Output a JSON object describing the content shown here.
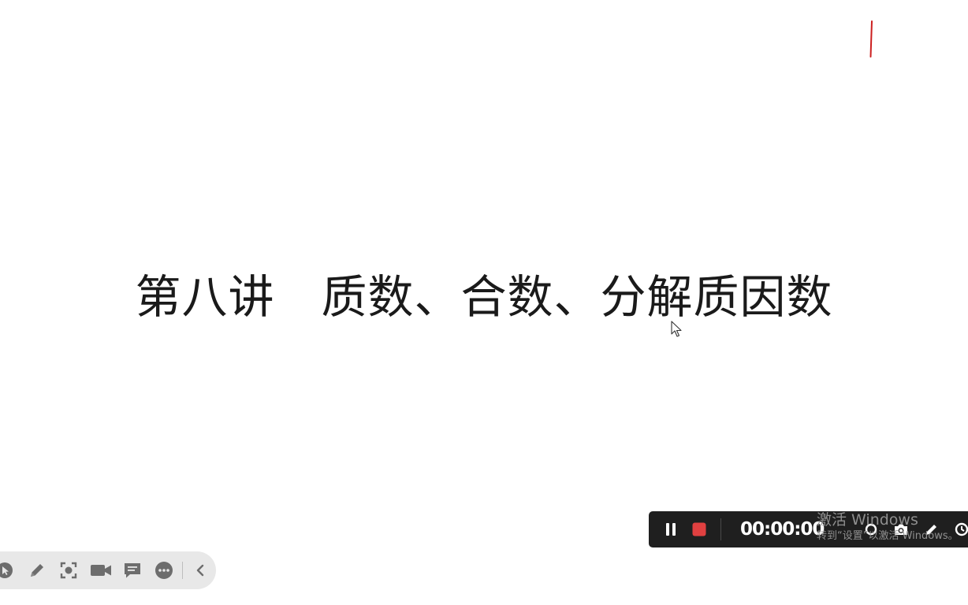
{
  "slide": {
    "title": "第八讲　质数、合数、分解质因数"
  },
  "annotation": {
    "pen_color": "#cc1f1f"
  },
  "left_toolbar": {
    "items": [
      {
        "icon": "pointer-icon"
      },
      {
        "icon": "pen-icon"
      },
      {
        "icon": "spotlight-icon"
      },
      {
        "icon": "camera-icon"
      },
      {
        "icon": "comment-icon"
      },
      {
        "icon": "more-icon"
      },
      {
        "icon": "collapse-chevron-icon"
      }
    ],
    "background": "#e8e8e8",
    "icon_color": "#6d6d6d"
  },
  "recorder": {
    "timer": "00:00:00",
    "stop_color": "#e04040",
    "background": "#1f1f1f",
    "buttons": [
      "pause-icon",
      "stop-icon",
      "webcam-icon",
      "screenshot-icon",
      "draw-icon",
      "schedule-icon"
    ]
  },
  "watermark": {
    "line1": "激活 Windows",
    "line2": "转到“设置”以激活 Windows。"
  }
}
